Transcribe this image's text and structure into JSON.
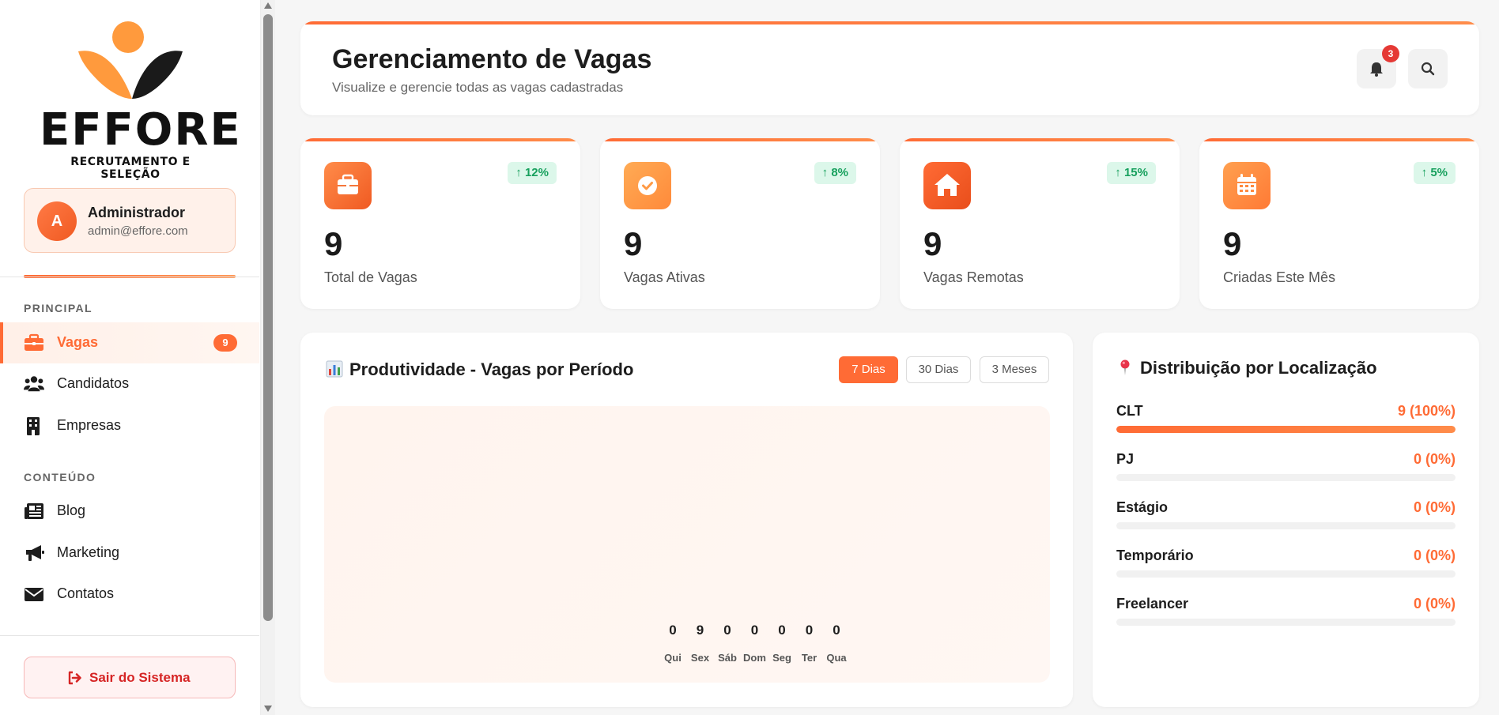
{
  "brand": {
    "name": "EFFORE",
    "tagline": "RECRUTAMENTO E SELEÇÃO"
  },
  "user": {
    "initial": "A",
    "name": "Administrador",
    "email": "admin@effore.com"
  },
  "nav": {
    "section_main": "PRINCIPAL",
    "section_content": "CONTEÚDO",
    "items": [
      {
        "label": "Vagas",
        "icon": "briefcase-icon",
        "badge": "9",
        "active": true
      },
      {
        "label": "Candidatos",
        "icon": "users-icon"
      },
      {
        "label": "Empresas",
        "icon": "building-icon"
      },
      {
        "label": "Blog",
        "icon": "newspaper-icon"
      },
      {
        "label": "Marketing",
        "icon": "megaphone-icon"
      },
      {
        "label": "Contatos",
        "icon": "envelope-icon"
      }
    ],
    "logout_label": "Sair do Sistema"
  },
  "header": {
    "title": "Gerenciamento de Vagas",
    "subtitle": "Visualize e gerencie todas as vagas cadastradas",
    "notification_count": "3"
  },
  "stats": [
    {
      "value": "9",
      "label": "Total de Vagas",
      "trend": "12%",
      "icon": "briefcase-icon"
    },
    {
      "value": "9",
      "label": "Vagas Ativas",
      "trend": "8%",
      "icon": "check-circle-icon"
    },
    {
      "value": "9",
      "label": "Vagas Remotas",
      "trend": "15%",
      "icon": "home-icon"
    },
    {
      "value": "9",
      "label": "Criadas Este Mês",
      "trend": "5%",
      "icon": "calendar-icon"
    }
  ],
  "productivity": {
    "title": "Produtividade - Vagas por Período",
    "periods": [
      "7 Dias",
      "30 Dias",
      "3 Meses"
    ],
    "selected_period": "7 Dias"
  },
  "chart_data": {
    "type": "bar",
    "title": "Produtividade - Vagas por Período",
    "categories": [
      "Qui",
      "Sex",
      "Sáb",
      "Dom",
      "Seg",
      "Ter",
      "Qua"
    ],
    "values": [
      0,
      9,
      0,
      0,
      0,
      0,
      0
    ],
    "xlabel": "",
    "ylabel": ""
  },
  "distribution": {
    "title": "Distribuição por Localização",
    "items": [
      {
        "name": "CLT",
        "value": "9 (100%)",
        "fraction": 1.0
      },
      {
        "name": "PJ",
        "value": "0 (0%)",
        "fraction": 0
      },
      {
        "name": "Estágio",
        "value": "0 (0%)",
        "fraction": 0
      },
      {
        "name": "Temporário",
        "value": "0 (0%)",
        "fraction": 0
      },
      {
        "name": "Freelancer",
        "value": "0 (0%)",
        "fraction": 0
      }
    ]
  },
  "colors": {
    "accent": "#ff6b35",
    "accent_light": "#ff9a5a",
    "success": "#17a05d",
    "danger": "#d62525"
  }
}
